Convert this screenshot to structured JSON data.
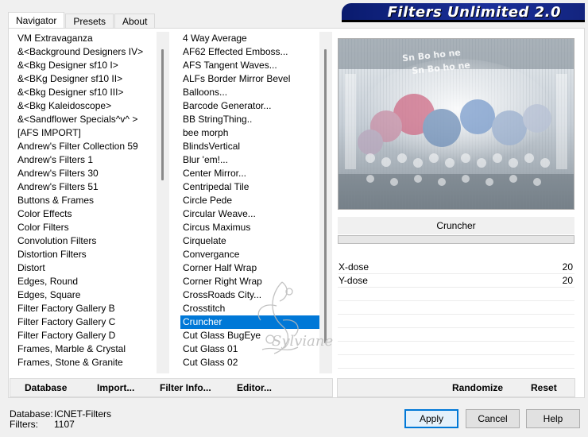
{
  "tabs": [
    "Navigator",
    "Presets",
    "About"
  ],
  "banner_title": "Filters Unlimited 2.0",
  "categories": [
    "VM Extravaganza",
    "&<Background Designers IV>",
    "&<Bkg Designer sf10 I>",
    "&<BKg Designer sf10 II>",
    "&<Bkg Designer sf10 III>",
    "&<Bkg Kaleidoscope>",
    "&<Sandflower Specials^v^ >",
    "[AFS IMPORT]",
    "Andrew's Filter Collection 59",
    "Andrew's Filters 1",
    "Andrew's Filters 30",
    "Andrew's Filters 51",
    "Buttons & Frames",
    "Color Effects",
    "Color Filters",
    "Convolution Filters",
    "Distortion Filters",
    "Distort",
    "Edges, Round",
    "Edges, Square",
    "Filter Factory Gallery B",
    "Filter Factory Gallery C",
    "Filter Factory Gallery D",
    "Frames, Marble & Crystal",
    "Frames, Stone & Granite"
  ],
  "filters": [
    "4 Way Average",
    "AF62 Effected Emboss...",
    "AFS Tangent Waves...",
    "ALFs Border Mirror Bevel",
    "Balloons...",
    "Barcode Generator...",
    "BB StringThing..",
    "bee morph",
    "BlindsVertical",
    "Blur 'em!...",
    "Center Mirror...",
    "Centripedal Tile",
    "Circle Pede",
    "Circular Weave...",
    "Circus Maximus",
    "Cirquelate",
    "Convergance",
    "Corner Half Wrap",
    "Corner Right Wrap",
    "CrossRoads City...",
    "Crosstitch",
    "Cruncher",
    "Cut Glass  BugEye",
    "Cut Glass 01",
    "Cut Glass 02"
  ],
  "selected_filter": "Cruncher",
  "params": [
    {
      "name": "X-dose",
      "value": "20"
    },
    {
      "name": "Y-dose",
      "value": "20"
    }
  ],
  "toolbar": {
    "database": "Database",
    "import": "Import...",
    "filter_info": "Filter Info...",
    "editor": "Editor...",
    "randomize": "Randomize",
    "reset": "Reset"
  },
  "footer": {
    "database_label": "Database:",
    "database_value": "ICNET-Filters",
    "filters_label": "Filters:",
    "filters_value": "1107"
  },
  "buttons": {
    "apply": "Apply",
    "cancel": "Cancel",
    "help": "Help"
  },
  "watermark": "Sylviane",
  "colors": {
    "selection": "#0078d7",
    "banner": "#0a1b6e",
    "default_button_border": "#0078d7"
  }
}
